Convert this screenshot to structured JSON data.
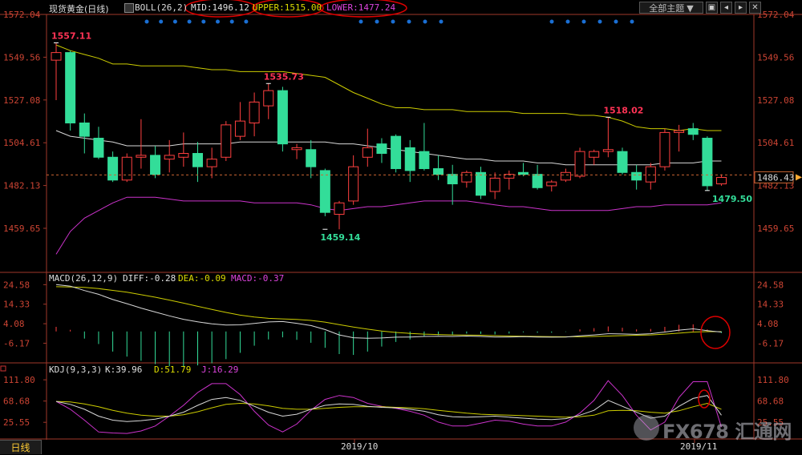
{
  "header": {
    "symbol": "现货黄金",
    "period": "(日线)",
    "boll_label": "BOLL(26,2)",
    "mid": "MID:1496.12",
    "upper": "UPPER:1515.00",
    "lower": "LOWER:1477.24",
    "theme_button": "全部主题",
    "theme_arrow": "▼",
    "buttons": [
      "▣",
      "◂",
      "▸",
      "✕"
    ]
  },
  "macd_header": {
    "label": "MACD(26,12,9)",
    "diff": "DIFF:-0.28",
    "dea": "DEA:-0.09",
    "macd": "MACD:-0.37"
  },
  "kdj_header": {
    "label": "KDJ(9,3,3)",
    "k": "K:39.96",
    "d": "D:51.79",
    "j": "J:16.29"
  },
  "bottom_tab": "日线",
  "date_labels": [
    "2019/10",
    "2019/11"
  ],
  "watermark": "FX678 汇通网",
  "colors": {
    "up": "#ff4040",
    "down": "#33dd99",
    "mid_line": "#d8d8d8",
    "upper_line": "#cccc00",
    "lower_line": "#cc33cc",
    "dea_line": "#cccc00",
    "j_line": "#cc33cc",
    "axis": "#a0382a",
    "annotation": "#dd0000",
    "dot": "#1a6fd4"
  },
  "chart_data": [
    {
      "type": "candlestick",
      "title": "现货黄金(日线) BOLL(26,2)",
      "y_ticks": [
        1572.04,
        1549.56,
        1527.08,
        1504.61,
        1482.13,
        1459.65
      ],
      "ylim": [
        1436.5,
        1572.04
      ],
      "last_price_label": "1486.43",
      "annotations": [
        {
          "text": "1557.11",
          "value": 1557.11,
          "index": 0
        },
        {
          "text": "1535.73",
          "value": 1535.73,
          "index": 15
        },
        {
          "text": "1459.14",
          "value": 1459.14,
          "index": 19
        },
        {
          "text": "1518.02",
          "value": 1518.02,
          "index": 39
        },
        {
          "text": "1479.50",
          "value": 1479.5,
          "index": 46
        }
      ],
      "candles": [
        {
          "o": 1548,
          "h": 1557.1,
          "l": 1527,
          "c": 1552
        },
        {
          "o": 1552,
          "h": 1553,
          "l": 1511,
          "c": 1515
        },
        {
          "o": 1515,
          "h": 1520,
          "l": 1499,
          "c": 1508
        },
        {
          "o": 1507,
          "h": 1513,
          "l": 1496,
          "c": 1497
        },
        {
          "o": 1497,
          "h": 1500,
          "l": 1484,
          "c": 1485
        },
        {
          "o": 1485,
          "h": 1499,
          "l": 1484,
          "c": 1497
        },
        {
          "o": 1497,
          "h": 1517,
          "l": 1491,
          "c": 1498
        },
        {
          "o": 1498,
          "h": 1503,
          "l": 1486,
          "c": 1488
        },
        {
          "o": 1496,
          "h": 1506,
          "l": 1489,
          "c": 1498
        },
        {
          "o": 1497,
          "h": 1510,
          "l": 1492,
          "c": 1499
        },
        {
          "o": 1499,
          "h": 1505,
          "l": 1484,
          "c": 1492
        },
        {
          "o": 1492,
          "h": 1502,
          "l": 1486,
          "c": 1496
        },
        {
          "o": 1497,
          "h": 1516,
          "l": 1495,
          "c": 1514
        },
        {
          "o": 1508,
          "h": 1526,
          "l": 1506,
          "c": 1516
        },
        {
          "o": 1515,
          "h": 1531,
          "l": 1508,
          "c": 1526
        },
        {
          "o": 1524,
          "h": 1535.7,
          "l": 1517,
          "c": 1532
        },
        {
          "o": 1532,
          "h": 1534,
          "l": 1500,
          "c": 1504
        },
        {
          "o": 1501,
          "h": 1504,
          "l": 1496,
          "c": 1502
        },
        {
          "o": 1501,
          "h": 1506,
          "l": 1486,
          "c": 1492
        },
        {
          "o": 1490,
          "h": 1491,
          "l": 1466,
          "c": 1468
        },
        {
          "o": 1467,
          "h": 1474,
          "l": 1459.1,
          "c": 1473
        },
        {
          "o": 1474,
          "h": 1498,
          "l": 1472,
          "c": 1492
        },
        {
          "o": 1497,
          "h": 1512,
          "l": 1492,
          "c": 1502
        },
        {
          "o": 1504,
          "h": 1507,
          "l": 1494,
          "c": 1499
        },
        {
          "o": 1508,
          "h": 1509,
          "l": 1489,
          "c": 1491
        },
        {
          "o": 1502,
          "h": 1506,
          "l": 1484,
          "c": 1490
        },
        {
          "o": 1500,
          "h": 1515,
          "l": 1490,
          "c": 1491
        },
        {
          "o": 1491,
          "h": 1498,
          "l": 1485,
          "c": 1488
        },
        {
          "o": 1488,
          "h": 1493,
          "l": 1472,
          "c": 1483
        },
        {
          "o": 1484,
          "h": 1490,
          "l": 1481,
          "c": 1489
        },
        {
          "o": 1489,
          "h": 1492,
          "l": 1475,
          "c": 1477
        },
        {
          "o": 1479,
          "h": 1489,
          "l": 1475,
          "c": 1486
        },
        {
          "o": 1486,
          "h": 1490,
          "l": 1480,
          "c": 1488
        },
        {
          "o": 1489,
          "h": 1494,
          "l": 1487,
          "c": 1488
        },
        {
          "o": 1488,
          "h": 1493,
          "l": 1480,
          "c": 1481
        },
        {
          "o": 1482,
          "h": 1485,
          "l": 1479,
          "c": 1484
        },
        {
          "o": 1485,
          "h": 1491,
          "l": 1484,
          "c": 1489
        },
        {
          "o": 1487,
          "h": 1502,
          "l": 1486,
          "c": 1500
        },
        {
          "o": 1497,
          "h": 1501,
          "l": 1493,
          "c": 1500
        },
        {
          "o": 1500,
          "h": 1518,
          "l": 1497,
          "c": 1501
        },
        {
          "o": 1500,
          "h": 1502,
          "l": 1488,
          "c": 1489
        },
        {
          "o": 1489,
          "h": 1493,
          "l": 1480,
          "c": 1485
        },
        {
          "o": 1484,
          "h": 1494,
          "l": 1480,
          "c": 1492
        },
        {
          "o": 1492,
          "h": 1512,
          "l": 1490,
          "c": 1510
        },
        {
          "o": 1510,
          "h": 1514,
          "l": 1500,
          "c": 1511
        },
        {
          "o": 1512,
          "h": 1515,
          "l": 1506,
          "c": 1509
        },
        {
          "o": 1507,
          "h": 1508,
          "l": 1479.5,
          "c": 1482
        },
        {
          "o": 1483,
          "h": 1488,
          "l": 1482,
          "c": 1486.4
        }
      ],
      "mid": [
        1511,
        1508,
        1507,
        1506,
        1505,
        1503,
        1503,
        1503,
        1503,
        1504,
        1504,
        1504,
        1504,
        1505,
        1505,
        1505,
        1505,
        1505,
        1505,
        1505,
        1504,
        1504,
        1503,
        1502,
        1501,
        1500,
        1499,
        1498,
        1497,
        1496,
        1496,
        1495,
        1495,
        1495,
        1494,
        1494,
        1493,
        1493,
        1493,
        1493,
        1493,
        1493,
        1493,
        1494,
        1494,
        1494,
        1495,
        1495
      ],
      "upper": [
        1556,
        1553,
        1551,
        1549,
        1546,
        1546,
        1545,
        1545,
        1545,
        1545,
        1544,
        1543,
        1543,
        1542,
        1542,
        1542,
        1542,
        1541,
        1540,
        1539,
        1535,
        1531,
        1528,
        1525,
        1523,
        1523,
        1522,
        1522,
        1522,
        1521,
        1521,
        1521,
        1521,
        1520,
        1520,
        1520,
        1520,
        1519,
        1519,
        1518,
        1516,
        1513,
        1512,
        1512,
        1511,
        1512,
        1511,
        1511
      ],
      "lower": [
        1446,
        1458,
        1465,
        1469,
        1473,
        1476,
        1476,
        1476,
        1475,
        1474,
        1474,
        1474,
        1474,
        1474,
        1473,
        1473,
        1473,
        1473,
        1472,
        1470,
        1469,
        1470,
        1471,
        1471,
        1472,
        1473,
        1474,
        1474,
        1474,
        1474,
        1473,
        1472,
        1471,
        1471,
        1470,
        1469,
        1469,
        1469,
        1469,
        1469,
        1470,
        1471,
        1471,
        1472,
        1472,
        1472,
        1472,
        1473
      ]
    },
    {
      "type": "bar",
      "title": "MACD(26,12,9)",
      "y_ticks": [
        24.58,
        14.33,
        4.08,
        -6.17
      ],
      "ylim": [
        -16.5,
        26.0
      ],
      "diff": [
        24.6,
        23.8,
        21.5,
        19.5,
        16.8,
        14.6,
        12.3,
        10.2,
        8.2,
        6.4,
        5.1,
        4.0,
        3.4,
        3.5,
        4.2,
        5.0,
        5.2,
        4.3,
        3.1,
        1.0,
        -1.8,
        -3.3,
        -3.6,
        -3.4,
        -3.0,
        -2.9,
        -2.6,
        -2.5,
        -2.6,
        -2.4,
        -2.6,
        -2.9,
        -2.9,
        -2.7,
        -2.9,
        -3.0,
        -2.9,
        -2.3,
        -1.8,
        -1.2,
        -1.3,
        -1.5,
        -1.2,
        -0.3,
        0.7,
        1.4,
        0.4,
        -0.28
      ],
      "dea": [
        23.5,
        23.4,
        23.2,
        22.5,
        21.6,
        20.6,
        19.3,
        18.0,
        16.5,
        14.9,
        13.2,
        11.6,
        10.0,
        8.6,
        7.6,
        6.9,
        6.6,
        6.3,
        5.8,
        4.9,
        3.6,
        2.3,
        1.2,
        0.2,
        -0.5,
        -1.0,
        -1.4,
        -1.6,
        -1.8,
        -1.9,
        -2.0,
        -2.2,
        -2.4,
        -2.5,
        -2.6,
        -2.7,
        -2.8,
        -2.8,
        -2.6,
        -2.4,
        -2.2,
        -2.0,
        -1.8,
        -1.4,
        -0.9,
        -0.3,
        -0.1,
        -0.09
      ],
      "macd_hist": [
        1.1,
        0.4,
        -1.7,
        -3.0,
        -4.8,
        -6.0,
        -7.0,
        -7.8,
        -8.3,
        -8.5,
        -8.1,
        -7.6,
        -6.6,
        -5.1,
        -3.4,
        -1.9,
        -1.4,
        -2.0,
        -2.7,
        -3.9,
        -5.4,
        -5.6,
        -4.8,
        -3.6,
        -2.5,
        -1.9,
        -1.2,
        -0.9,
        -0.8,
        -0.5,
        -0.6,
        -0.7,
        -0.5,
        -0.2,
        -0.3,
        -0.3,
        -0.1,
        0.5,
        0.8,
        1.2,
        0.9,
        0.5,
        0.6,
        1.1,
        1.6,
        1.7,
        0.5,
        -0.37
      ],
      "annotation": "circle"
    },
    {
      "type": "line",
      "title": "KDJ(9,3,3)",
      "y_ticks": [
        111.8,
        68.68,
        25.55
      ],
      "ylim": [
        -5,
        125
      ],
      "k": [
        68,
        62,
        52,
        38,
        30,
        27,
        29,
        32,
        38,
        46,
        60,
        72,
        76,
        70,
        58,
        46,
        38,
        42,
        52,
        60,
        63,
        62,
        58,
        56,
        55,
        52,
        48,
        41,
        37,
        36,
        37,
        38,
        36,
        34,
        32,
        31,
        33,
        40,
        50,
        70,
        58,
        46,
        34,
        38,
        58,
        74,
        80,
        40
      ],
      "d": [
        68,
        67,
        63,
        57,
        50,
        44,
        40,
        38,
        38,
        41,
        47,
        55,
        62,
        64,
        63,
        59,
        54,
        52,
        52,
        54,
        56,
        57,
        57,
        57,
        56,
        55,
        53,
        50,
        47,
        44,
        42,
        41,
        40,
        39,
        38,
        37,
        36,
        37,
        40,
        49,
        50,
        49,
        46,
        44,
        49,
        57,
        64,
        52
      ],
      "j": [
        68,
        52,
        30,
        6,
        4,
        3,
        8,
        18,
        38,
        60,
        86,
        104,
        104,
        82,
        48,
        20,
        6,
        22,
        50,
        72,
        80,
        76,
        64,
        58,
        54,
        48,
        40,
        26,
        18,
        18,
        24,
        30,
        28,
        22,
        18,
        18,
        26,
        44,
        70,
        110,
        80,
        40,
        10,
        26,
        76,
        108,
        108,
        16
      ],
      "annotation": "circle"
    }
  ]
}
